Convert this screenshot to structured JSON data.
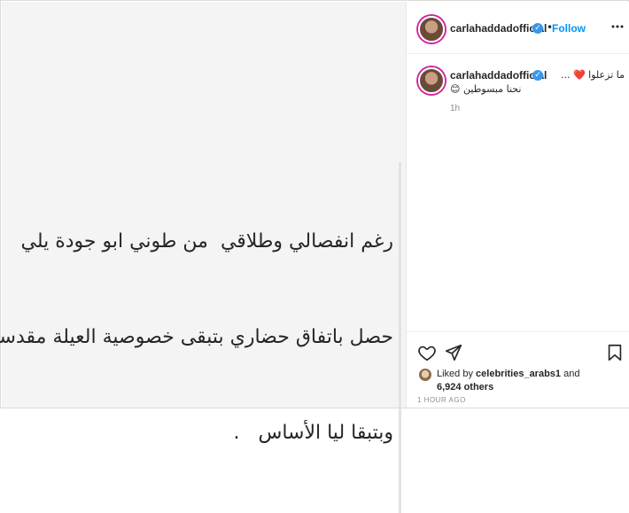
{
  "post": {
    "text_lines": [
      "رغم انفصالي وطلاقي  من طوني ابو جودة يلي",
      "حصل باتفاق حضاري بتبقى خصوصية العيلة مقدسة",
      "وبتبقا ليا الأساس   ."
    ]
  },
  "header": {
    "username": "carlahaddadofficial",
    "separator": "•",
    "follow_label": "Follow"
  },
  "comment": {
    "username": "carlahaddadofficial",
    "line1": "ما تزعلوا ❤️ ...",
    "line2": "نحنا مبسوطين 😊",
    "time": "1h"
  },
  "actions": {
    "liked_by_prefix": "Liked by ",
    "liked_by_user": "celebrities_arabs1",
    "liked_by_and": " and",
    "others_count": "6,924 others",
    "timestamp": "1 HOUR AGO"
  },
  "colors": {
    "accent": "#0095f6",
    "verified": "#3897f0",
    "text": "#262626",
    "muted": "#8e8e8e"
  },
  "icons": [
    "more-icon",
    "verified-icon",
    "heart-icon",
    "share-icon",
    "bookmark-icon"
  ]
}
